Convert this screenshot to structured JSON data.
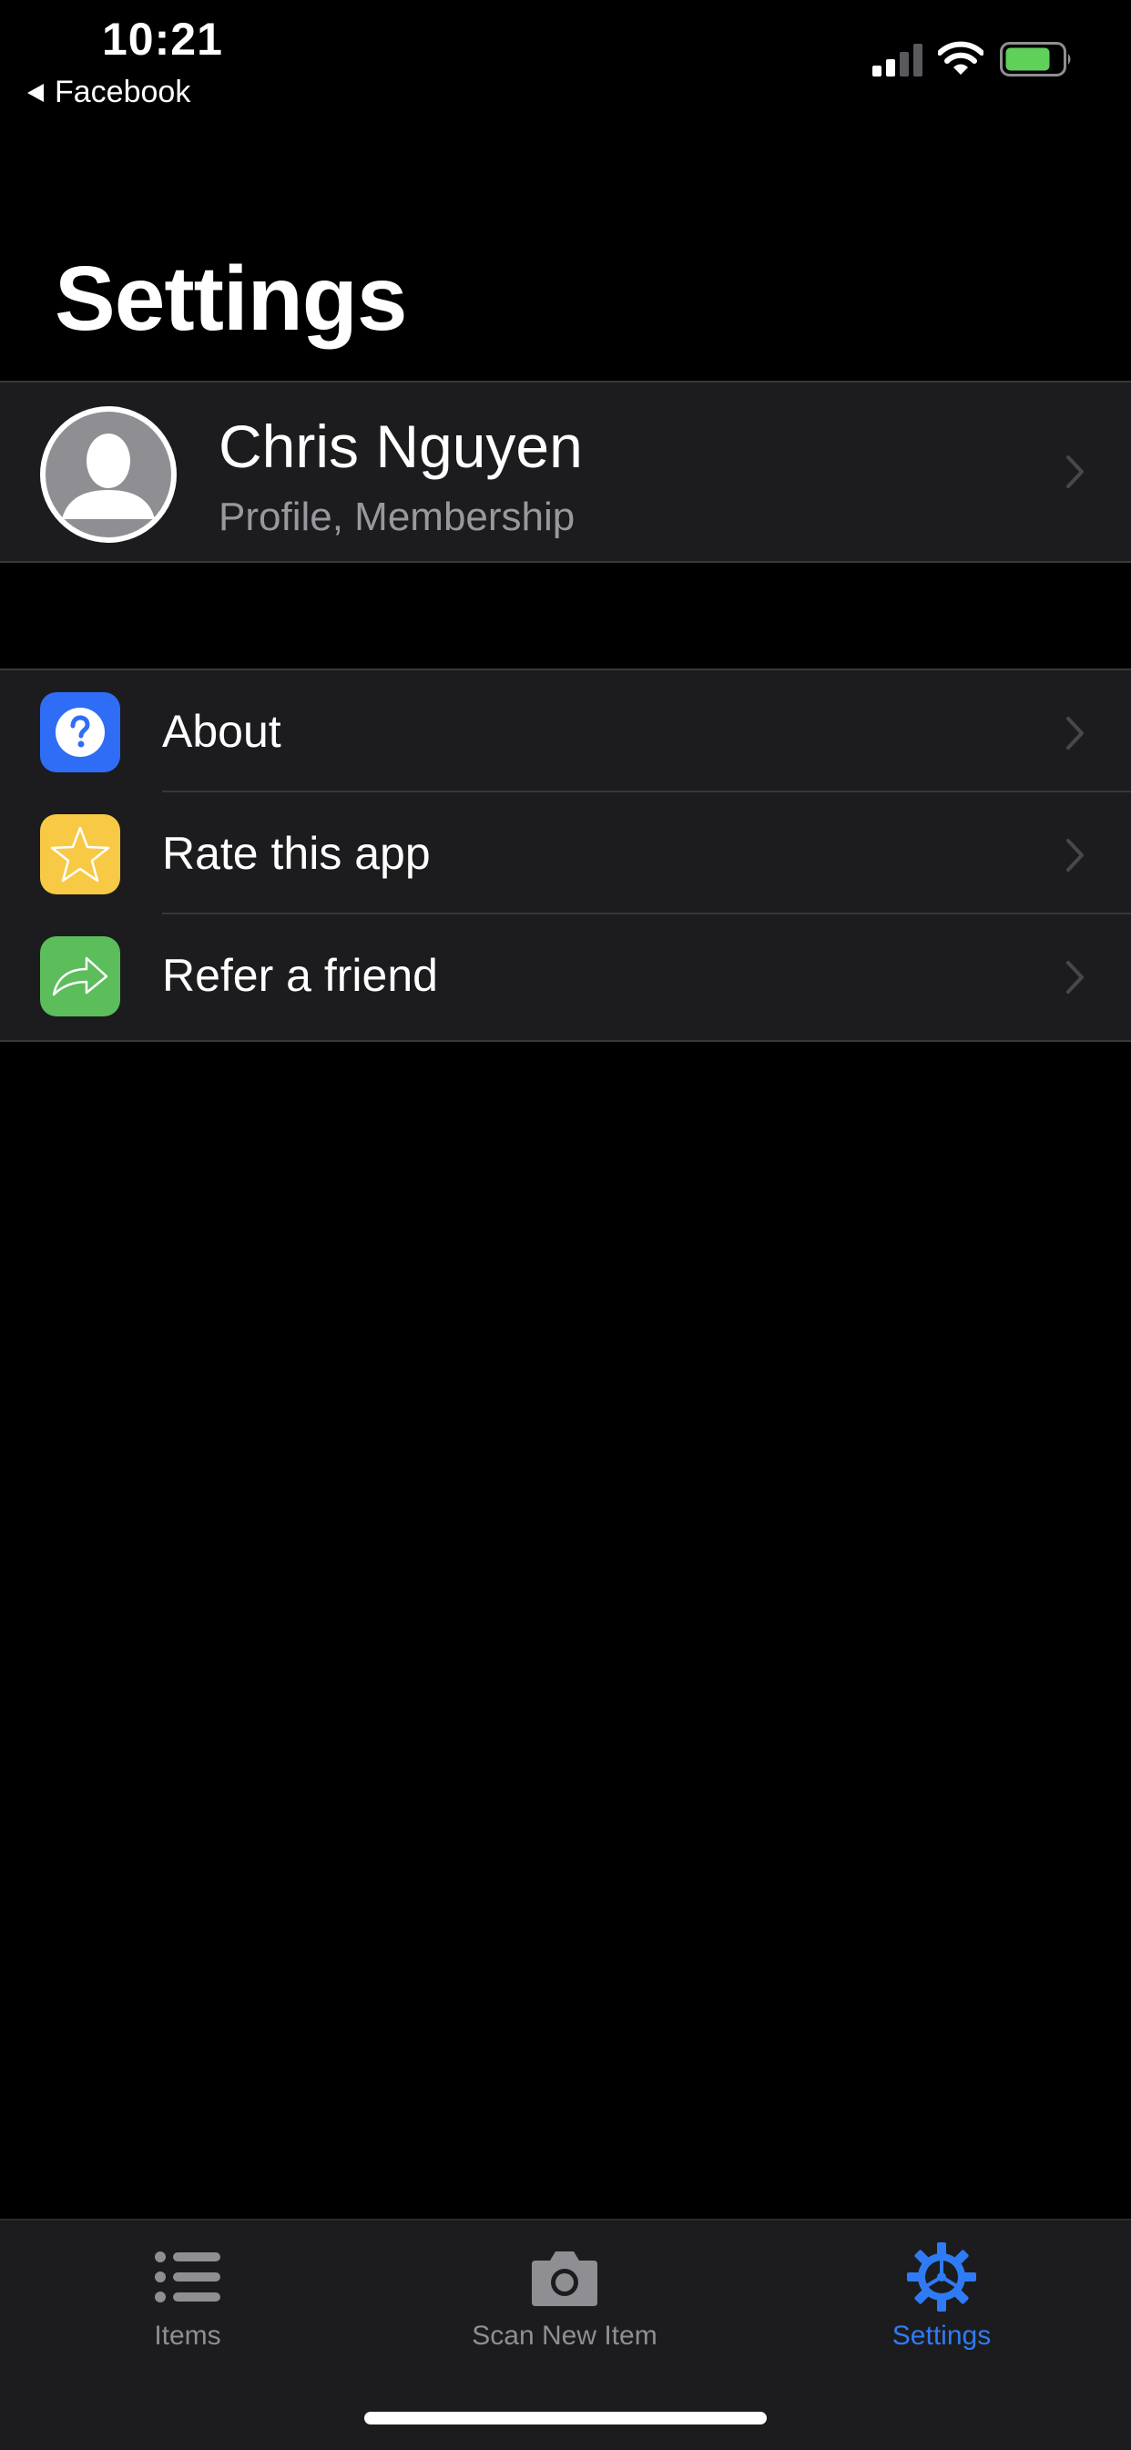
{
  "status_bar": {
    "time": "10:21",
    "back_app": "Facebook",
    "battery_color": "#5fd05a"
  },
  "header": {
    "title": "Settings"
  },
  "profile": {
    "name": "Chris Nguyen",
    "subtitle": "Profile, Membership"
  },
  "menu": {
    "items": [
      {
        "label": "About",
        "icon": "question-icon",
        "icon_bg": "#2f6df6"
      },
      {
        "label": "Rate this app",
        "icon": "star-icon",
        "icon_bg": "#f7c945"
      },
      {
        "label": "Refer a friend",
        "icon": "share-arrow-icon",
        "icon_bg": "#5cbd5b"
      }
    ]
  },
  "tab_bar": {
    "tabs": [
      {
        "label": "Items",
        "icon": "list-icon",
        "active": false
      },
      {
        "label": "Scan New Item",
        "icon": "camera-icon",
        "active": false
      },
      {
        "label": "Settings",
        "icon": "gear-icon",
        "active": true
      }
    ],
    "active_color": "#2f7bf6",
    "inactive_color": "#8e8e93"
  }
}
